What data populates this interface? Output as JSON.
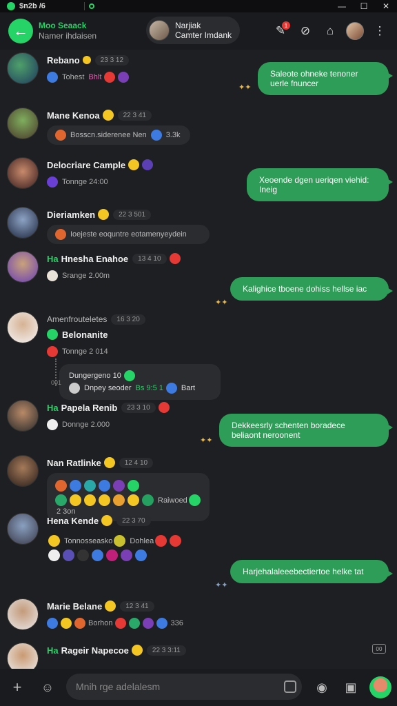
{
  "window": {
    "title": "$n2b /6",
    "controls": [
      "—",
      "☐",
      "✕"
    ]
  },
  "header": {
    "name": "Moo Seaack",
    "subtitle": "Namer ihdaisen",
    "contact_name": "Narjiak",
    "contact_sub": "Camter Imdank",
    "notif_count": "1",
    "accent": "#25d366"
  },
  "messages": [
    {
      "name": "Rebano",
      "time": "23 3 12",
      "sub": "Tohest",
      "sub2": "Bhlt"
    },
    {
      "name": "Mane Kenoa",
      "time": "22 3 41",
      "pill": "Bosscn.siderenee Nen",
      "pill_end": "3.3k"
    },
    {
      "name": "Delocriare Cample",
      "sub": "Tonnge 24:00"
    },
    {
      "name": "Dieriamken",
      "time": "22 3 501",
      "pill": "Ioejeste eoquntre eotamenyeydein"
    },
    {
      "tag": "Ha",
      "name": "Hnesha Enahoe",
      "time": "13 4 10",
      "sub": "Srange 2.00m"
    },
    {
      "name": "Amenfrouteletes",
      "time": "16 3 20",
      "name2": "Belonanite",
      "sub": "Tonnge 2 014",
      "quote_title": "Dungergeno 10",
      "quote_body": "Dnpey seoder",
      "quote_green": "Bs 9:5 1",
      "quote_end": "Bart",
      "quote_side": "001"
    },
    {
      "tag": "Ha",
      "name": "Papela Renib",
      "time": "23 3 10",
      "sub": "Donnge 2.000"
    },
    {
      "name": "Nan Ratlinke",
      "time": "12 4 10",
      "grid_text": "Raiwoed",
      "grid_end": "2 3on"
    },
    {
      "name": "Hena Kende",
      "time": "22 3 70",
      "pill": "Tonnosseasko",
      "pill2": "Dohlea"
    },
    {
      "name": "Marie Belane",
      "time": "12 3 41",
      "sub": "Borhon",
      "sub_end": "336"
    },
    {
      "tag": "Ha",
      "name": "Rageir Napecoe",
      "time": "22 3 3:11"
    }
  ],
  "outgoing": [
    {
      "text": "Saleote ohneke tenoner uerle fnuncer"
    },
    {
      "text": "Xeoende dgen ueriqen viehid: Ineig"
    },
    {
      "text": "Kalighice tboene dohiss hellse iac"
    },
    {
      "text": "Dekkeesrly schenten boradece beliaont neroonent"
    },
    {
      "text": "Harjehalaleeebectiertoe helke tat"
    }
  ],
  "composer": {
    "placeholder": "Mnih rge adelalesm",
    "page_label": "00"
  }
}
